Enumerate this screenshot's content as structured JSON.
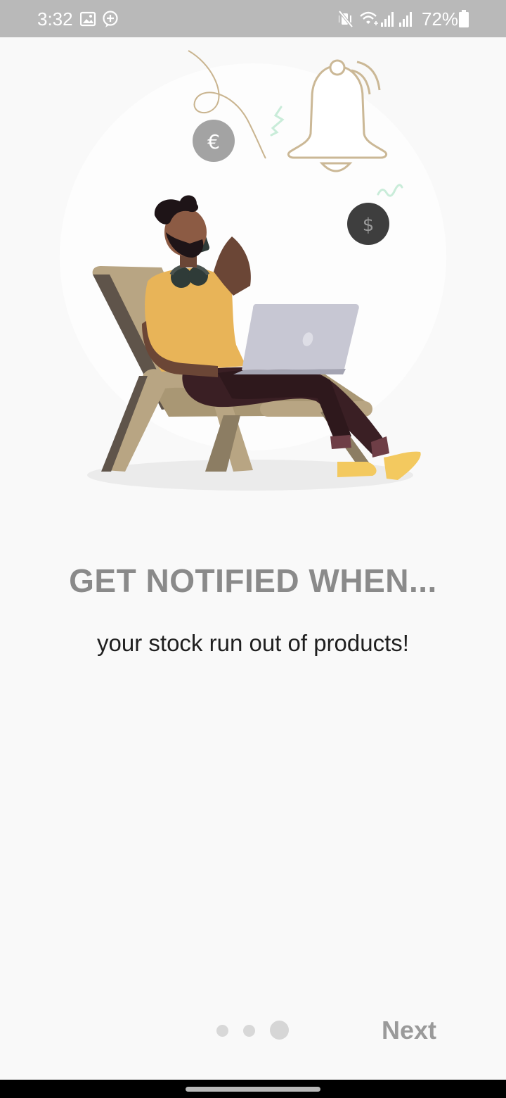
{
  "status_bar": {
    "time": "3:32",
    "battery_percent": "72%",
    "icons_left": [
      "image-icon",
      "chat-add-icon"
    ],
    "icons_right": [
      "mute-vibrate-icon",
      "wifi-icon",
      "signal-icon",
      "signal-icon",
      "battery-icon"
    ]
  },
  "onboarding": {
    "title": "GET NOTIFIED WHEN...",
    "subtitle": "your stock run out of products!",
    "illustration": {
      "euro_symbol": "€",
      "dollar_symbol": "$",
      "icons": [
        "bell-icon",
        "euro-coin-icon",
        "dollar-coin-icon"
      ]
    }
  },
  "pager": {
    "total_pages": 3,
    "current_page": 3
  },
  "actions": {
    "next_label": "Next"
  },
  "colors": {
    "status_bar": "#b9b9b9",
    "background": "#f9f9f9",
    "headline": "#8a8a8a",
    "next": "#9a9a9a",
    "shirt": "#e8b458",
    "chair": "#b8a583",
    "laptop": "#c7c7d3"
  }
}
